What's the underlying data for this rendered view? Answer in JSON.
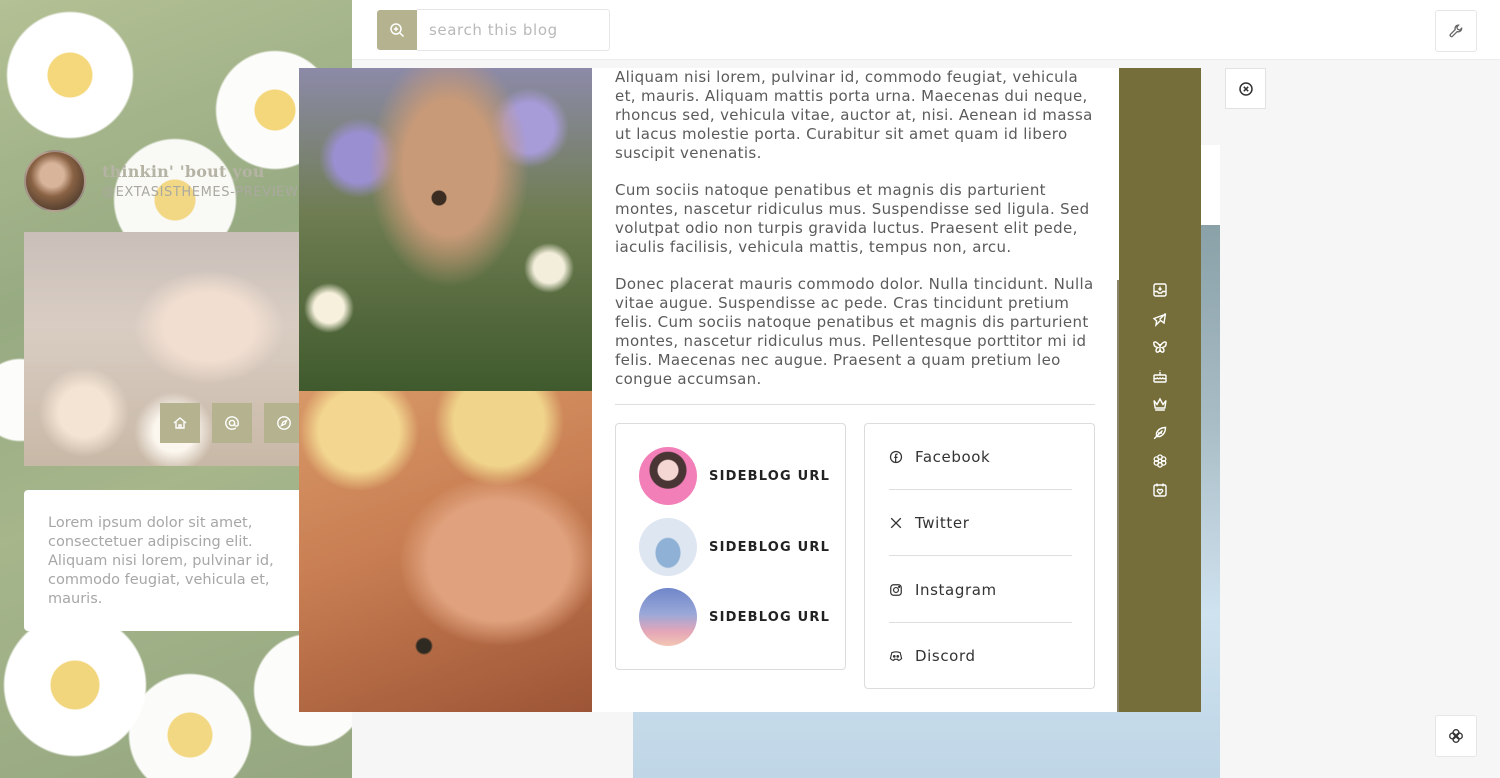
{
  "search": {
    "placeholder": "search this blog"
  },
  "profile": {
    "title": "thinkin' 'bout you",
    "handle": "@EXTASISTHEMES-PREVIEW"
  },
  "sidebar_nav": [
    "home-icon",
    "at-icon",
    "compass-icon"
  ],
  "description": "Lorem ipsum dolor sit amet, consectetuer adipiscing elit. Aliquam nisi lorem, pulvinar id, commodo feugiat, vehicula et, mauris.",
  "popup": {
    "paragraphs": [
      "Aliquam nisi lorem, pulvinar id, commodo feugiat, vehicula et, mauris. Aliquam mattis porta urna. Maecenas dui neque, rhoncus sed, vehicula vitae, auctor at, nisi. Aenean id massa ut lacus molestie porta. Curabitur sit amet quam id libero suscipit venenatis.",
      "Cum sociis natoque penatibus et magnis dis parturient montes, nascetur ridiculus mus. Suspendisse sed ligula. Sed volutpat odio non turpis gravida luctus. Praesent elit pede, iaculis facilisis, vehicula mattis, tempus non, arcu.",
      "Donec placerat mauris commodo dolor. Nulla tincidunt. Nulla vitae augue. Suspendisse ac pede. Cras tincidunt pretium felis. Cum sociis natoque penatibus et magnis dis parturient montes, nascetur ridiculus mus. Pellentesque porttitor mi id felis. Maecenas nec augue. Praesent a quam pretium leo congue accumsan."
    ],
    "sideblogs": [
      {
        "label": "SIDEBLOG URL"
      },
      {
        "label": "SIDEBLOG URL"
      },
      {
        "label": "SIDEBLOG URL"
      }
    ],
    "socials": [
      {
        "label": "Facebook",
        "icon": "facebook-icon"
      },
      {
        "label": "Twitter",
        "icon": "x-twitter-icon"
      },
      {
        "label": "Instagram",
        "icon": "instagram-icon"
      },
      {
        "label": "Discord",
        "icon": "discord-icon"
      }
    ],
    "strip_icons": [
      "inbox-icon",
      "plane-icon",
      "butterfly-icon",
      "cake-icon",
      "crown-icon",
      "feather-icon",
      "flower-icon",
      "calendar-heart-icon"
    ]
  },
  "colors": {
    "accent": "#b5b38f",
    "strip": "#766e3a"
  }
}
